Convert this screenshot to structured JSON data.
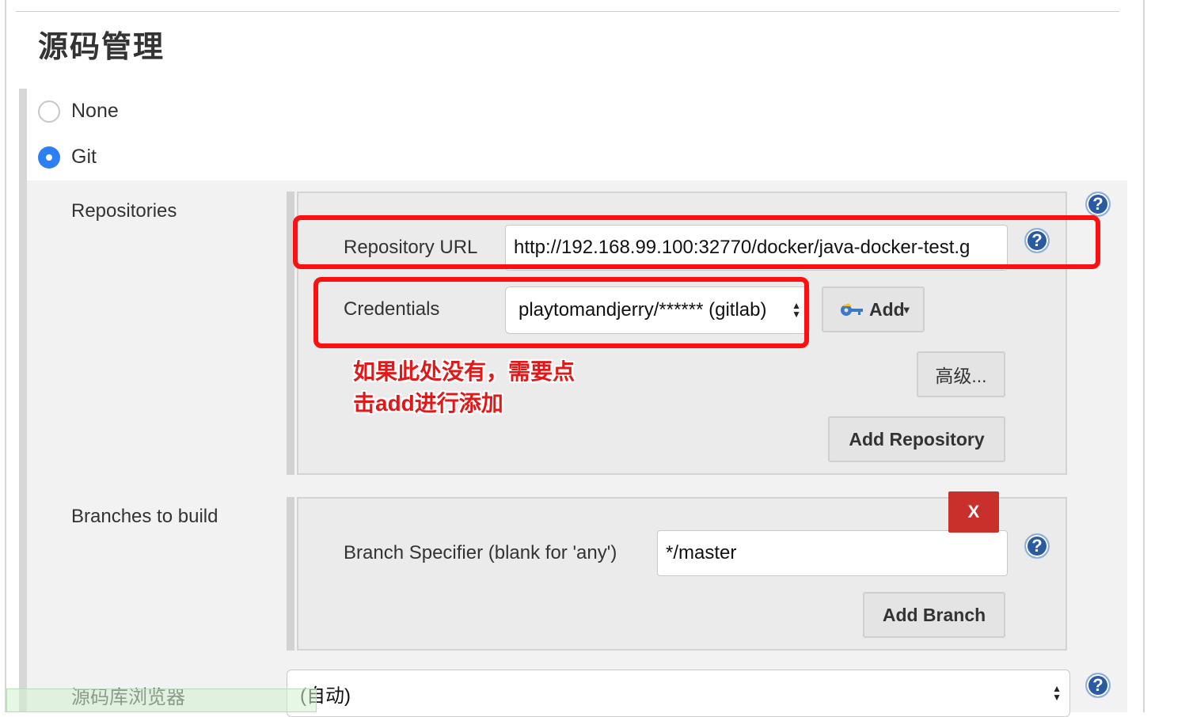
{
  "section": {
    "title": "源码管理"
  },
  "scm_options": [
    {
      "label": "None",
      "selected": false
    },
    {
      "label": "Git",
      "selected": true
    }
  ],
  "repositories": {
    "label": "Repositories",
    "url_label": "Repository URL",
    "url_value": "http://192.168.99.100:32770/docker/java-docker-test.g",
    "credentials_label": "Credentials",
    "credentials_value": "playtomandjerry/****** (gitlab)",
    "add_credentials_label": "Add",
    "advanced_label": "高级...",
    "add_repository_label": "Add Repository"
  },
  "annotation": {
    "line1": "如果此处没有，需要点",
    "line2": "击add进行添加",
    "color": "#e01818"
  },
  "branches": {
    "label": "Branches to build",
    "delete_label": "X",
    "specifier_label": "Branch Specifier (blank for 'any')",
    "specifier_value": "*/master",
    "add_branch_label": "Add Branch"
  },
  "repo_browser": {
    "label": "源码库浏览器",
    "value": "(自动)"
  },
  "icons": {
    "help": "question-mark-icon",
    "key": "key-icon",
    "dropdown": "chevron-down-icon",
    "updown": "updown-arrows-icon"
  },
  "help_glyph": "?",
  "colors": {
    "accent_blue": "#2d7ff5",
    "highlight_red": "#ff1010",
    "delete_red": "#c9302c",
    "help_blue": "#2a5aa0"
  }
}
